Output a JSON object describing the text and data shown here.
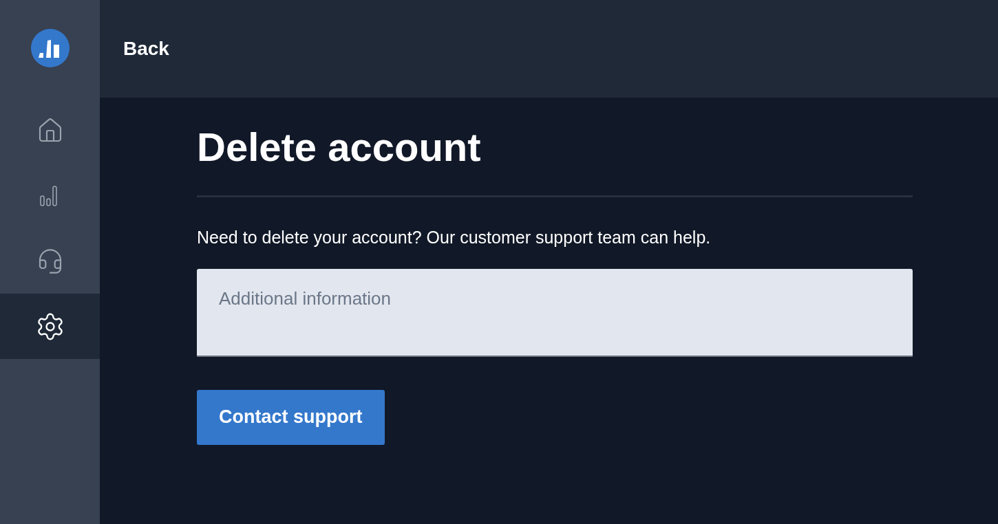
{
  "header": {
    "back_link": "Back"
  },
  "sidebar": {
    "items": [
      {
        "kind": "home",
        "selected": false
      },
      {
        "kind": "chart",
        "selected": false
      },
      {
        "kind": "support",
        "selected": false
      },
      {
        "kind": "settings",
        "selected": true
      }
    ]
  },
  "page": {
    "title": "Delete account",
    "description": "Need to delete your account? Our customer support team can help.",
    "field": {
      "placeholder": "Additional information"
    },
    "button": "Contact support"
  }
}
